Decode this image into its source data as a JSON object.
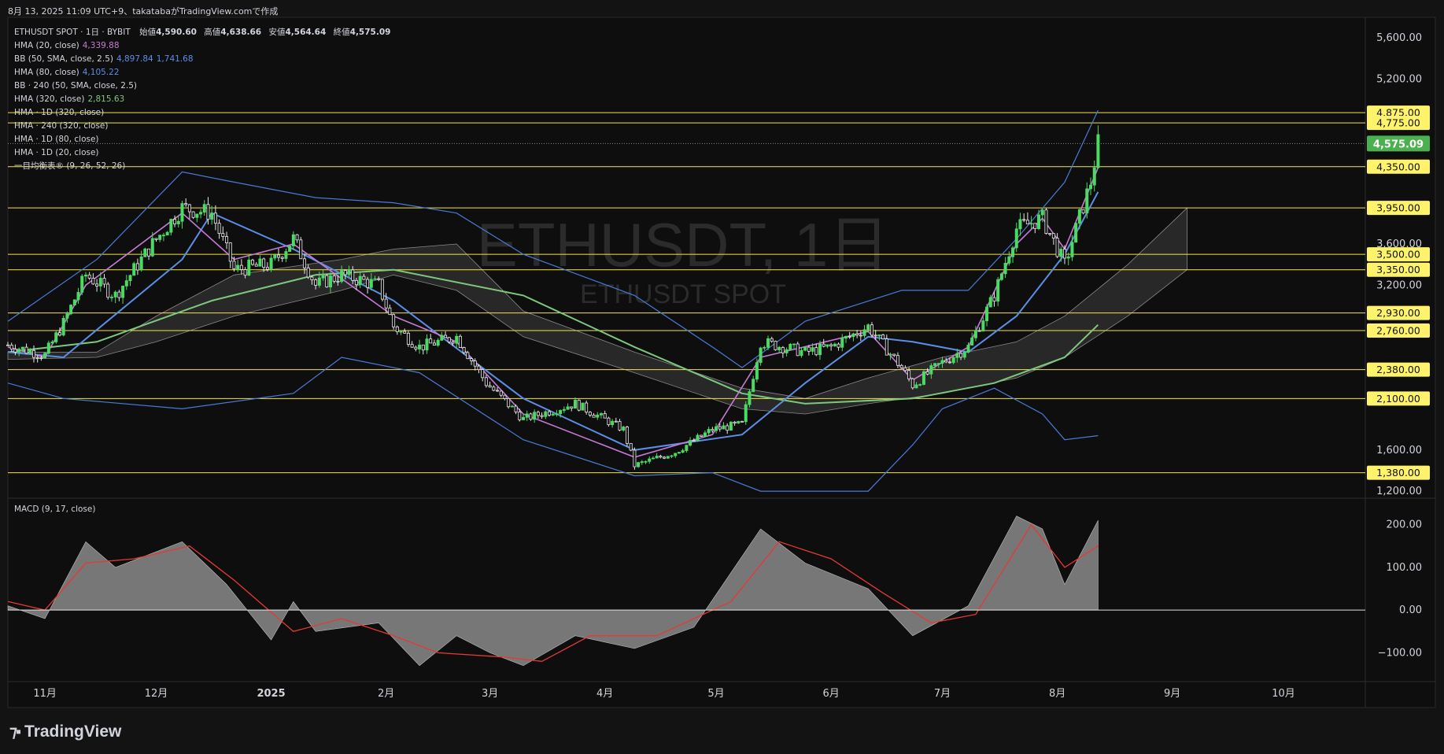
{
  "caption": "8月 13, 2025 11:09 UTC+9、takatabaがTradingView.comで作成",
  "watermark": {
    "symbol": "ETHUSDT, 1日",
    "name": "ETHUSDT SPOT"
  },
  "legend": {
    "header": {
      "label": "ETHUSDT SPOT · 1日 · BYBIT",
      "open_label": "始値",
      "open": "4,590.60",
      "high_label": "高値",
      "high": "4,638.66",
      "low_label": "安値",
      "low": "4,564.64",
      "close_label": "終値",
      "close": "4,575.09"
    },
    "indicators": [
      {
        "label": "HMA (20, close)",
        "values": [
          "4,339.88"
        ],
        "color": "#c77ad5"
      },
      {
        "label": "BB (50, SMA, close, 2.5)",
        "values": [
          "4,897.84",
          "1,741.68"
        ],
        "color": "#5b8fe6"
      },
      {
        "label": "HMA (80, close)",
        "values": [
          "4,105.22"
        ],
        "color": "#5b8fe6"
      },
      {
        "label": "BB · 240 (50, SMA, close, 2.5)",
        "values": [],
        "color": "#d1d4dc"
      },
      {
        "label": "HMA (320, close)",
        "values": [
          "2,815.63"
        ],
        "color": "#7ec87e"
      },
      {
        "label": "HMA · 1D (320, close)",
        "values": [],
        "color": "#d1d4dc"
      },
      {
        "label": "HMA · 240 (320, close)",
        "values": [],
        "color": "#d1d4dc"
      },
      {
        "label": "HMA · 1D (80, close)",
        "values": [],
        "color": "#d1d4dc"
      },
      {
        "label": "HMA · 1D (20, close)",
        "values": [],
        "color": "#d1d4dc"
      },
      {
        "label": "一目均衡表® (9, 26, 52, 26)",
        "values": [],
        "color": "#d1d4dc"
      }
    ]
  },
  "macd_label": "MACD (9, 17, close)",
  "logo": "TradingView",
  "colors": {
    "up": "#26a69a",
    "down": "#ef5350",
    "level": "#f5e642",
    "hma20": "#c77ad5",
    "hma80": "#5b8fe6",
    "hma320": "#7ec87e",
    "price_tag": "#4caf50"
  },
  "chart_data": [
    {
      "type": "candlestick",
      "ylim": [
        1140,
        5800
      ],
      "y_ticks": [
        "5,600.00",
        "5,200.00",
        "3,600.00",
        "3,200.00",
        "1,600.00",
        "1,200.00"
      ],
      "x_ticks": [
        "11月",
        "12月",
        "2025",
        "2月",
        "3月",
        "4月",
        "5月",
        "6月",
        "7月",
        "8月",
        "9月",
        "10月"
      ],
      "horizontal_levels": [
        {
          "value": 4875,
          "label": "4,875.00"
        },
        {
          "value": 4775,
          "label": "4,775.00"
        },
        {
          "value": 4350,
          "label": "4,350.00"
        },
        {
          "value": 3950,
          "label": "3,950.00"
        },
        {
          "value": 3500,
          "label": "3,500.00"
        },
        {
          "value": 3350,
          "label": "3,350.00"
        },
        {
          "value": 2930,
          "label": "2,930.00"
        },
        {
          "value": 2760,
          "label": "2,760.00"
        },
        {
          "value": 2380,
          "label": "2,380.00"
        },
        {
          "value": 2100,
          "label": "2,100.00"
        },
        {
          "value": 1380,
          "label": "1,380.00"
        }
      ],
      "last_price": {
        "value": 4575.09,
        "label": "4,575.09"
      },
      "close_path": [
        [
          "2024-10-22",
          2620
        ],
        [
          "2024-11-01",
          2520
        ],
        [
          "2024-11-06",
          2830
        ],
        [
          "2024-11-12",
          3300
        ],
        [
          "2024-11-20",
          3100
        ],
        [
          "2024-11-30",
          3600
        ],
        [
          "2024-12-08",
          3950
        ],
        [
          "2024-12-16",
          3900
        ],
        [
          "2024-12-22",
          3350
        ],
        [
          "2025-01-01",
          3400
        ],
        [
          "2025-01-07",
          3650
        ],
        [
          "2025-01-13",
          3200
        ],
        [
          "2025-01-20",
          3300
        ],
        [
          "2025-01-30",
          3200
        ],
        [
          "2025-02-03",
          2800
        ],
        [
          "2025-02-10",
          2600
        ],
        [
          "2025-02-20",
          2700
        ],
        [
          "2025-02-28",
          2250
        ],
        [
          "2025-03-10",
          1900
        ],
        [
          "2025-03-24",
          2050
        ],
        [
          "2025-04-06",
          1800
        ],
        [
          "2025-04-09",
          1450
        ],
        [
          "2025-04-20",
          1580
        ],
        [
          "2025-04-30",
          1800
        ],
        [
          "2025-05-08",
          1850
        ],
        [
          "2025-05-13",
          2650
        ],
        [
          "2025-05-25",
          2550
        ],
        [
          "2025-06-01",
          2600
        ],
        [
          "2025-06-11",
          2800
        ],
        [
          "2025-06-20",
          2400
        ],
        [
          "2025-06-23",
          2230
        ],
        [
          "2025-07-01",
          2450
        ],
        [
          "2025-07-08",
          2600
        ],
        [
          "2025-07-15",
          3100
        ],
        [
          "2025-07-21",
          3750
        ],
        [
          "2025-07-28",
          3850
        ],
        [
          "2025-08-03",
          3400
        ],
        [
          "2025-08-10",
          4200
        ],
        [
          "2025-08-12",
          4575
        ]
      ],
      "ma_paths": {
        "hma20": [
          [
            "2024-10-22",
            2600
          ],
          [
            "2024-11-01",
            2500
          ],
          [
            "2024-11-12",
            3200
          ],
          [
            "2024-12-08",
            3900
          ],
          [
            "2024-12-22",
            3450
          ],
          [
            "2025-01-07",
            3600
          ],
          [
            "2025-02-03",
            2900
          ],
          [
            "2025-02-20",
            2650
          ],
          [
            "2025-03-10",
            1950
          ],
          [
            "2025-04-09",
            1530
          ],
          [
            "2025-04-30",
            1750
          ],
          [
            "2025-05-13",
            2500
          ],
          [
            "2025-06-11",
            2750
          ],
          [
            "2025-06-23",
            2280
          ],
          [
            "2025-07-08",
            2600
          ],
          [
            "2025-07-21",
            3600
          ],
          [
            "2025-07-28",
            3850
          ],
          [
            "2025-08-03",
            3550
          ],
          [
            "2025-08-12",
            4340
          ]
        ],
        "hma80": [
          [
            "2024-10-22",
            2550
          ],
          [
            "2024-11-06",
            2500
          ],
          [
            "2024-12-08",
            3450
          ],
          [
            "2024-12-16",
            3900
          ],
          [
            "2025-01-07",
            3550
          ],
          [
            "2025-02-03",
            3050
          ],
          [
            "2025-03-10",
            2100
          ],
          [
            "2025-04-09",
            1600
          ],
          [
            "2025-05-08",
            1750
          ],
          [
            "2025-05-25",
            2250
          ],
          [
            "2025-06-11",
            2700
          ],
          [
            "2025-06-23",
            2650
          ],
          [
            "2025-07-08",
            2550
          ],
          [
            "2025-07-21",
            2900
          ],
          [
            "2025-08-03",
            3500
          ],
          [
            "2025-08-12",
            4105
          ]
        ],
        "hma320": [
          [
            "2024-10-22",
            2550
          ],
          [
            "2024-11-15",
            2650
          ],
          [
            "2024-12-16",
            3050
          ],
          [
            "2025-01-13",
            3300
          ],
          [
            "2025-02-03",
            3350
          ],
          [
            "2025-03-10",
            3100
          ],
          [
            "2025-04-09",
            2600
          ],
          [
            "2025-05-08",
            2150
          ],
          [
            "2025-05-25",
            2050
          ],
          [
            "2025-06-23",
            2100
          ],
          [
            "2025-07-15",
            2250
          ],
          [
            "2025-08-03",
            2500
          ],
          [
            "2025-08-12",
            2815
          ]
        ],
        "bb_upper": [
          [
            "2024-10-22",
            2850
          ],
          [
            "2024-11-15",
            3450
          ],
          [
            "2024-12-08",
            4300
          ],
          [
            "2024-12-22",
            4200
          ],
          [
            "2025-01-13",
            4050
          ],
          [
            "2025-02-03",
            4000
          ],
          [
            "2025-02-20",
            3900
          ],
          [
            "2025-03-10",
            3500
          ],
          [
            "2025-04-09",
            3100
          ],
          [
            "2025-04-30",
            2600
          ],
          [
            "2025-05-08",
            2400
          ],
          [
            "2025-05-25",
            2850
          ],
          [
            "2025-06-20",
            3150
          ],
          [
            "2025-07-08",
            3150
          ],
          [
            "2025-07-21",
            3650
          ],
          [
            "2025-08-03",
            4200
          ],
          [
            "2025-08-12",
            4898
          ]
        ],
        "bb_lower": [
          [
            "2024-10-22",
            2250
          ],
          [
            "2024-11-06",
            2100
          ],
          [
            "2024-12-08",
            2000
          ],
          [
            "2025-01-07",
            2150
          ],
          [
            "2025-01-20",
            2500
          ],
          [
            "2025-02-10",
            2350
          ],
          [
            "2025-03-10",
            1700
          ],
          [
            "2025-04-09",
            1350
          ],
          [
            "2025-04-30",
            1380
          ],
          [
            "2025-05-13",
            1200
          ],
          [
            "2025-06-11",
            1200
          ],
          [
            "2025-06-23",
            1650
          ],
          [
            "2025-07-01",
            2000
          ],
          [
            "2025-07-15",
            2200
          ],
          [
            "2025-07-28",
            1950
          ],
          [
            "2025-08-03",
            1700
          ],
          [
            "2025-08-12",
            1740
          ]
        ],
        "cloud_top": [
          [
            "2024-10-22",
            2550
          ],
          [
            "2024-11-15",
            2550
          ],
          [
            "2024-12-01",
            2900
          ],
          [
            "2024-12-22",
            3300
          ],
          [
            "2025-01-20",
            3450
          ],
          [
            "2025-02-03",
            3550
          ],
          [
            "2025-02-20",
            3600
          ],
          [
            "2025-03-10",
            2950
          ],
          [
            "2025-04-09",
            2550
          ],
          [
            "2025-05-08",
            2200
          ],
          [
            "2025-05-25",
            2100
          ],
          [
            "2025-06-11",
            2300
          ],
          [
            "2025-07-01",
            2500
          ],
          [
            "2025-07-21",
            2650
          ],
          [
            "2025-08-03",
            2900
          ],
          [
            "2025-08-20",
            3400
          ],
          [
            "2025-09-05",
            3950
          ]
        ],
        "cloud_bottom": [
          [
            "2024-10-22",
            2480
          ],
          [
            "2024-11-15",
            2500
          ],
          [
            "2024-12-01",
            2650
          ],
          [
            "2024-12-22",
            2900
          ],
          [
            "2025-01-20",
            3150
          ],
          [
            "2025-02-03",
            3300
          ],
          [
            "2025-02-20",
            3150
          ],
          [
            "2025-03-10",
            2700
          ],
          [
            "2025-04-09",
            2350
          ],
          [
            "2025-05-08",
            2000
          ],
          [
            "2025-05-25",
            1950
          ],
          [
            "2025-06-11",
            2050
          ],
          [
            "2025-07-01",
            2150
          ],
          [
            "2025-07-21",
            2300
          ],
          [
            "2025-08-03",
            2500
          ],
          [
            "2025-08-20",
            2900
          ],
          [
            "2025-09-05",
            3350
          ]
        ]
      }
    },
    {
      "type": "area",
      "title": "MACD (9, 17, close)",
      "ylim": [
        -160,
        260
      ],
      "y_ticks": [
        "200.00",
        "100.00",
        "0.00",
        "−100.00"
      ],
      "macd": [
        [
          "2024-10-22",
          10
        ],
        [
          "2024-11-01",
          -20
        ],
        [
          "2024-11-12",
          160
        ],
        [
          "2024-11-20",
          100
        ],
        [
          "2024-12-08",
          160
        ],
        [
          "2024-12-20",
          60
        ],
        [
          "2025-01-01",
          -70
        ],
        [
          "2025-01-07",
          20
        ],
        [
          "2025-01-13",
          -50
        ],
        [
          "2025-01-30",
          -30
        ],
        [
          "2025-02-10",
          -130
        ],
        [
          "2025-02-20",
          -60
        ],
        [
          "2025-03-01",
          -100
        ],
        [
          "2025-03-10",
          -130
        ],
        [
          "2025-03-24",
          -60
        ],
        [
          "2025-04-09",
          -90
        ],
        [
          "2025-04-25",
          -40
        ],
        [
          "2025-05-13",
          190
        ],
        [
          "2025-05-25",
          110
        ],
        [
          "2025-06-11",
          50
        ],
        [
          "2025-06-23",
          -60
        ],
        [
          "2025-07-08",
          10
        ],
        [
          "2025-07-21",
          220
        ],
        [
          "2025-07-28",
          190
        ],
        [
          "2025-08-03",
          60
        ],
        [
          "2025-08-12",
          210
        ]
      ],
      "signal": [
        [
          "2024-10-22",
          20
        ],
        [
          "2024-11-01",
          0
        ],
        [
          "2024-11-12",
          110
        ],
        [
          "2024-11-25",
          120
        ],
        [
          "2024-12-10",
          150
        ],
        [
          "2024-12-22",
          70
        ],
        [
          "2025-01-07",
          -50
        ],
        [
          "2025-01-20",
          -20
        ],
        [
          "2025-02-03",
          -60
        ],
        [
          "2025-02-15",
          -100
        ],
        [
          "2025-03-05",
          -110
        ],
        [
          "2025-03-15",
          -120
        ],
        [
          "2025-03-28",
          -60
        ],
        [
          "2025-04-15",
          -60
        ],
        [
          "2025-05-05",
          20
        ],
        [
          "2025-05-18",
          160
        ],
        [
          "2025-06-01",
          120
        ],
        [
          "2025-06-15",
          40
        ],
        [
          "2025-06-28",
          -30
        ],
        [
          "2025-07-10",
          -10
        ],
        [
          "2025-07-25",
          200
        ],
        [
          "2025-08-03",
          100
        ],
        [
          "2025-08-12",
          150
        ]
      ]
    }
  ]
}
